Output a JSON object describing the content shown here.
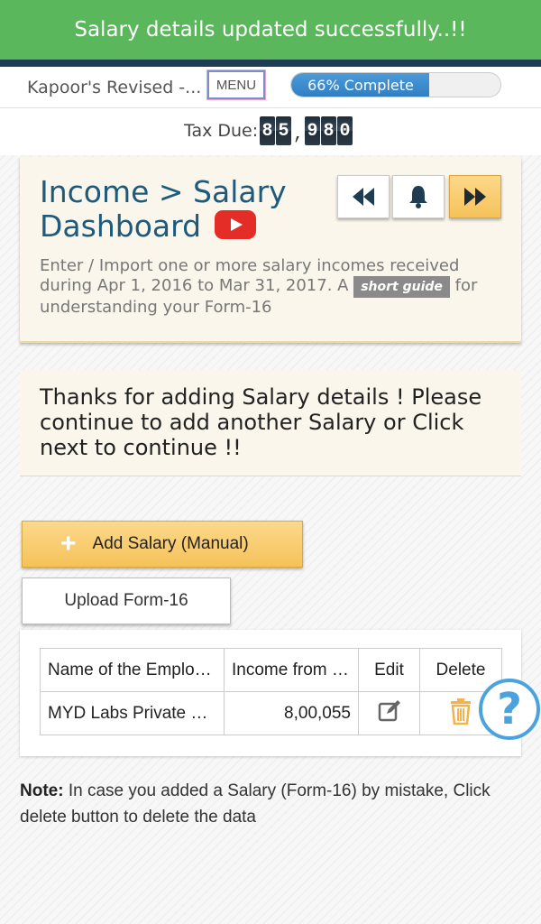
{
  "toast": {
    "message": "Salary details updated successfully..!!"
  },
  "header": {
    "return_name": "Kapoor's Revised -...",
    "menu_label": "MENU",
    "progress_percent": 66,
    "progress_label": "66% Complete"
  },
  "tax": {
    "label": "Tax Due:",
    "digits_group1": [
      "8",
      "5"
    ],
    "digits_group2": [
      "9",
      "8",
      "0"
    ]
  },
  "dashboard": {
    "title_line1": "Income > Salary",
    "title_line2": "Dashboard",
    "desc_part1": "Enter / Import one or more salary incomes received during Apr 1, 2016 to Mar 31, 2017. A",
    "short_guide": "short guide",
    "desc_part2": "for understanding your Form-16"
  },
  "thanks_message": "Thanks for adding Salary details ! Please continue to add another Salary or Click next to continue !!",
  "buttons": {
    "add_salary": "Add Salary (Manual)",
    "upload_form16": "Upload Form-16"
  },
  "table": {
    "headers": [
      "Name of the Employer",
      "Income from Salary",
      "Edit",
      "Delete"
    ],
    "rows": [
      {
        "employer": "MYD Labs Private Limited",
        "income": "8,00,055"
      }
    ]
  },
  "note": {
    "label": "Note:",
    "text": "In case you added a Salary (Form-16) by mistake, Click delete button to delete the data"
  },
  "colors": {
    "toast": "#5bb75b",
    "title": "#1d5a7b",
    "accent": "#f5c25a",
    "help": "#4aa3df"
  }
}
